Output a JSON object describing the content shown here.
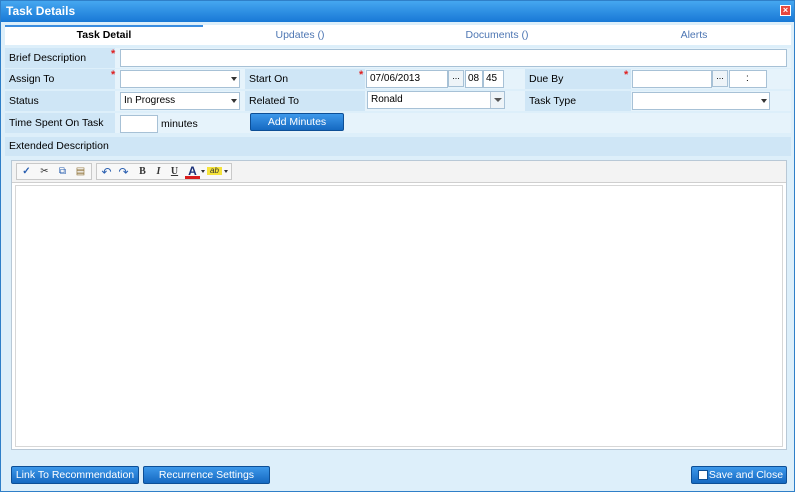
{
  "window": {
    "title": "Task Details",
    "close_glyph": "×"
  },
  "tabs": [
    {
      "label": "Task Detail",
      "active": true
    },
    {
      "label": "Updates ()",
      "active": false
    },
    {
      "label": "Documents ()",
      "active": false
    },
    {
      "label": "Alerts",
      "active": false
    }
  ],
  "form": {
    "brief_description": {
      "label": "Brief Description",
      "value": ""
    },
    "assign_to": {
      "label": "Assign To",
      "value": ""
    },
    "start_on": {
      "label": "Start On",
      "date": "07/06/2013",
      "hour": "08",
      "minute": "45",
      "picker_label": "..."
    },
    "due_by": {
      "label": "Due By",
      "date": "",
      "hour": "",
      "minute": "",
      "picker_label": "...",
      "separator": ":"
    },
    "status": {
      "label": "Status",
      "value": "In Progress"
    },
    "related_to": {
      "label": "Related To",
      "value": "Ronald"
    },
    "task_type": {
      "label": "Task Type",
      "value": ""
    },
    "time_spent": {
      "label": "Time Spent On Task",
      "value": "",
      "unit": "minutes"
    },
    "add_minutes_label": "Add Minutes",
    "required_marker": "*"
  },
  "extended_description": {
    "label": "Extended Description"
  },
  "editor_toolbar": {
    "buttons": [
      {
        "name": "spellcheck",
        "glyph": "✓"
      },
      {
        "name": "cut",
        "glyph": "✂"
      },
      {
        "name": "copy",
        "glyph": "⧉"
      },
      {
        "name": "paste",
        "glyph": "▤"
      },
      {
        "name": "undo",
        "glyph": "↶"
      },
      {
        "name": "redo",
        "glyph": "↷"
      },
      {
        "name": "bold",
        "glyph": "B"
      },
      {
        "name": "italic",
        "glyph": "I"
      },
      {
        "name": "underline",
        "glyph": "U"
      },
      {
        "name": "font-color",
        "glyph": "A"
      },
      {
        "name": "highlight",
        "glyph": "ab"
      }
    ],
    "font_color": "#d81c1c",
    "highlight_color": "#f5e33a"
  },
  "footer": {
    "link_recommendation": "Link To Recommendation",
    "recurrence": "Recurrence Settings",
    "save_close": "Save and Close"
  },
  "colors": {
    "accent": "#1f78d1",
    "title_bar": "#2f8fe6",
    "required": "#e02020"
  }
}
